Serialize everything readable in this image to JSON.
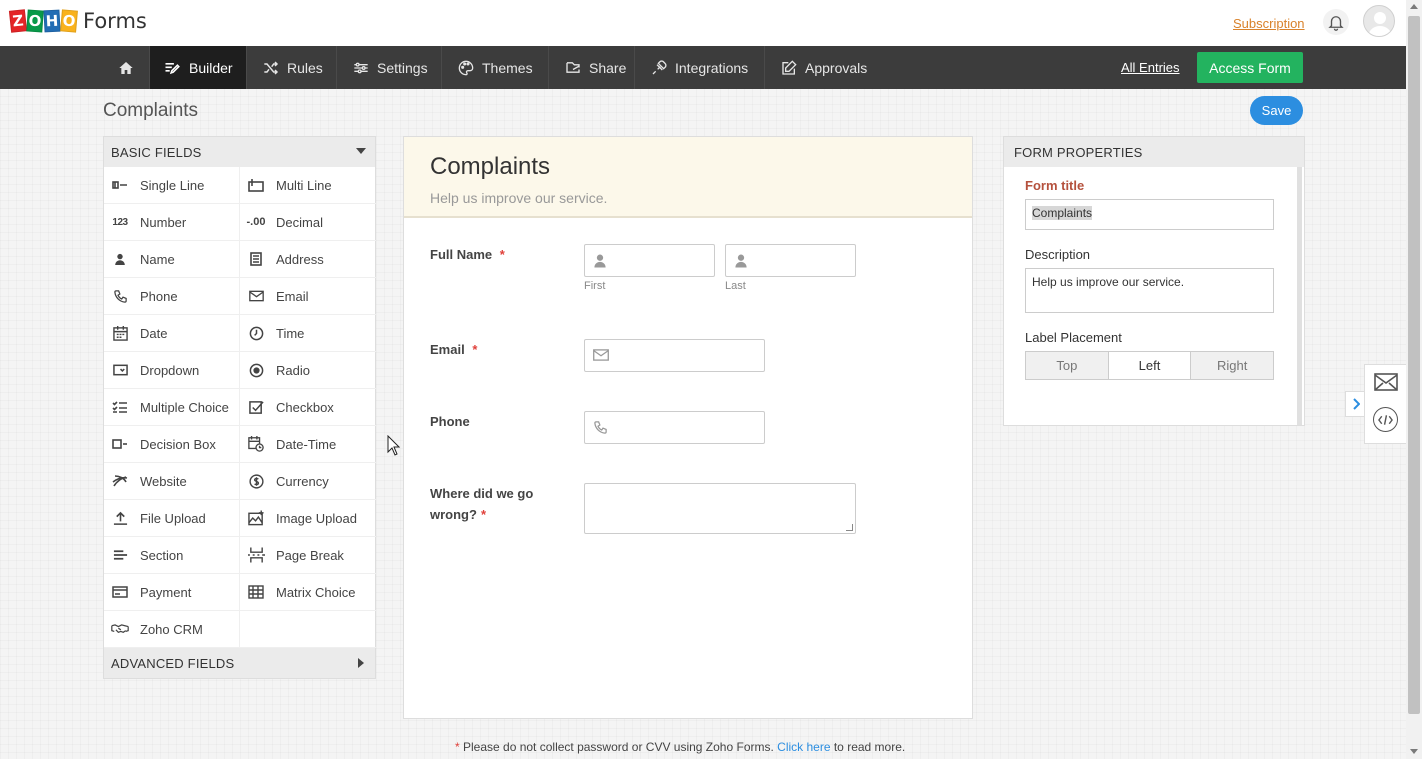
{
  "app": {
    "logo_letters": [
      {
        "ch": "Z",
        "color": "#e42527"
      },
      {
        "ch": "O",
        "color": "#089949"
      },
      {
        "ch": "H",
        "color": "#226db4"
      },
      {
        "ch": "O",
        "color": "#f9b21d"
      }
    ],
    "logo_product": "Forms",
    "subscription_label": "Subscription"
  },
  "nav": {
    "items": [
      {
        "label": "Builder",
        "icon": "builder-icon"
      },
      {
        "label": "Rules",
        "icon": "shuffle-icon"
      },
      {
        "label": "Settings",
        "icon": "settings-icon"
      },
      {
        "label": "Themes",
        "icon": "palette-icon"
      },
      {
        "label": "Share",
        "icon": "share-icon"
      },
      {
        "label": "Integrations",
        "icon": "puzzle-icon"
      },
      {
        "label": "Approvals",
        "icon": "edit-icon"
      }
    ],
    "active": "Builder",
    "all_entries_label": "All Entries",
    "access_form_label": "Access Form"
  },
  "page": {
    "title": "Complaints",
    "save_label": "Save"
  },
  "fields_panel": {
    "basic_heading": "BASIC FIELDS",
    "advanced_heading": "ADVANCED FIELDS",
    "items": [
      {
        "label": "Single Line",
        "icon": "single-line-icon"
      },
      {
        "label": "Multi Line",
        "icon": "multi-line-icon"
      },
      {
        "label": "Number",
        "icon": "number-icon"
      },
      {
        "label": "Decimal",
        "icon": "decimal-icon"
      },
      {
        "label": "Name",
        "icon": "person-icon"
      },
      {
        "label": "Address",
        "icon": "address-icon"
      },
      {
        "label": "Phone",
        "icon": "phone-icon"
      },
      {
        "label": "Email",
        "icon": "envelope-icon"
      },
      {
        "label": "Date",
        "icon": "calendar-icon"
      },
      {
        "label": "Time",
        "icon": "clock-icon"
      },
      {
        "label": "Dropdown",
        "icon": "dropdown-icon"
      },
      {
        "label": "Radio",
        "icon": "radio-icon"
      },
      {
        "label": "Multiple Choice",
        "icon": "checklist-icon"
      },
      {
        "label": "Checkbox",
        "icon": "checkbox-icon"
      },
      {
        "label": "Decision Box",
        "icon": "decision-box-icon"
      },
      {
        "label": "Date-Time",
        "icon": "calendar-clock-icon"
      },
      {
        "label": "Website",
        "icon": "globe-icon"
      },
      {
        "label": "Currency",
        "icon": "dollar-icon"
      },
      {
        "label": "File Upload",
        "icon": "upload-icon"
      },
      {
        "label": "Image Upload",
        "icon": "image-icon"
      },
      {
        "label": "Section",
        "icon": "section-icon"
      },
      {
        "label": "Page Break",
        "icon": "page-break-icon"
      },
      {
        "label": "Payment",
        "icon": "card-icon"
      },
      {
        "label": "Matrix Choice",
        "icon": "grid-icon"
      },
      {
        "label": "Zoho CRM",
        "icon": "handshake-icon"
      },
      {
        "label": "",
        "icon": ""
      }
    ]
  },
  "form": {
    "title": "Complaints",
    "description": "Help us improve our service.",
    "fields": {
      "full_name_label": "Full Name",
      "first_sublabel": "First",
      "last_sublabel": "Last",
      "email_label": "Email",
      "phone_label": "Phone",
      "wrong_label_line1": "Where did we go",
      "wrong_label_line2": "wrong?",
      "required_mark": "*"
    }
  },
  "footnote": {
    "star": "*",
    "text": " Please do not collect password or CVV using Zoho Forms. ",
    "link": "Click here",
    "after": " to read more."
  },
  "properties": {
    "heading": "FORM PROPERTIES",
    "title_label": "Form title",
    "title_value": "Complaints",
    "description_label": "Description",
    "description_value": "Help us improve our service.",
    "placement_label": "Label Placement",
    "placement_options": [
      "Top",
      "Left",
      "Right"
    ],
    "placement_selected": "Left"
  }
}
